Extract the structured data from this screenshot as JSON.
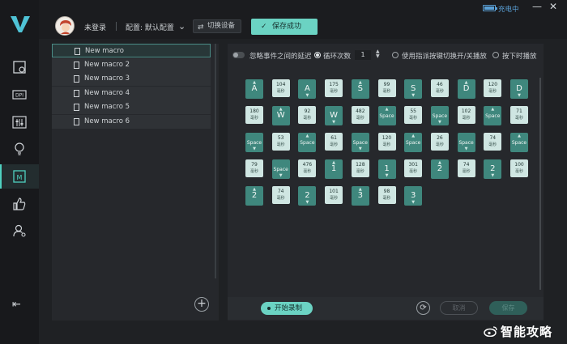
{
  "header": {
    "user_name": "未登录",
    "config_label": "配置: 默认配置",
    "switch_device": "切换设备",
    "save_status": "保存成功",
    "battery_level_percent": 100,
    "charging": "充电中"
  },
  "macros": [
    {
      "name": "New macro",
      "active": true
    },
    {
      "name": "New macro 2"
    },
    {
      "name": "New macro 3"
    },
    {
      "name": "New macro 4"
    },
    {
      "name": "New macro 5"
    },
    {
      "name": "New macro 6"
    }
  ],
  "options": {
    "ignore_delay": "忽略事件之间的延迟",
    "loop_count_label": "循环次数",
    "loop_count": "1",
    "toggle_mode": "使用指派按键切换开/关播放",
    "press_mode": "按下时播放"
  },
  "events": [
    {
      "type": "key",
      "label": "A",
      "dir": "down"
    },
    {
      "type": "delay",
      "value": "104",
      "unit": "毫秒"
    },
    {
      "type": "key",
      "label": "A",
      "dir": "up"
    },
    {
      "type": "delay",
      "value": "175",
      "unit": "毫秒"
    },
    {
      "type": "key",
      "label": "S",
      "dir": "down"
    },
    {
      "type": "delay",
      "value": "99",
      "unit": "毫秒"
    },
    {
      "type": "key",
      "label": "S",
      "dir": "up"
    },
    {
      "type": "delay",
      "value": "46",
      "unit": "毫秒"
    },
    {
      "type": "key",
      "label": "D",
      "dir": "down"
    },
    {
      "type": "delay",
      "value": "120",
      "unit": "毫秒"
    },
    {
      "type": "key",
      "label": "D",
      "dir": "up"
    },
    {
      "type": "delay",
      "value": "180",
      "unit": "毫秒"
    },
    {
      "type": "key",
      "label": "W",
      "dir": "down"
    },
    {
      "type": "delay",
      "value": "92",
      "unit": "毫秒"
    },
    {
      "type": "key",
      "label": "W",
      "dir": "up"
    },
    {
      "type": "delay",
      "value": "482",
      "unit": "毫秒"
    },
    {
      "type": "key",
      "label": "Space",
      "dir": "down"
    },
    {
      "type": "delay",
      "value": "55",
      "unit": "毫秒"
    },
    {
      "type": "key",
      "label": "Space",
      "dir": "up"
    },
    {
      "type": "delay",
      "value": "102",
      "unit": "毫秒"
    },
    {
      "type": "key",
      "label": "Space",
      "dir": "down"
    },
    {
      "type": "delay",
      "value": "71",
      "unit": "毫秒"
    },
    {
      "type": "key",
      "label": "Space",
      "dir": "up"
    },
    {
      "type": "delay",
      "value": "53",
      "unit": "毫秒"
    },
    {
      "type": "key",
      "label": "Space",
      "dir": "down"
    },
    {
      "type": "delay",
      "value": "61",
      "unit": "毫秒"
    },
    {
      "type": "key",
      "label": "Space",
      "dir": "up"
    },
    {
      "type": "delay",
      "value": "120",
      "unit": "毫秒"
    },
    {
      "type": "key",
      "label": "Space",
      "dir": "down"
    },
    {
      "type": "delay",
      "value": "26",
      "unit": "毫秒"
    },
    {
      "type": "key",
      "label": "Space",
      "dir": "up"
    },
    {
      "type": "delay",
      "value": "74",
      "unit": "毫秒"
    },
    {
      "type": "key",
      "label": "Space",
      "dir": "down"
    },
    {
      "type": "delay",
      "value": "79",
      "unit": "毫秒"
    },
    {
      "type": "key",
      "label": "Space",
      "dir": "up"
    },
    {
      "type": "delay",
      "value": "476",
      "unit": "毫秒"
    },
    {
      "type": "key",
      "label": "1",
      "dir": "down"
    },
    {
      "type": "delay",
      "value": "128",
      "unit": "毫秒"
    },
    {
      "type": "key",
      "label": "1",
      "dir": "up"
    },
    {
      "type": "delay",
      "value": "301",
      "unit": "毫秒"
    },
    {
      "type": "key",
      "label": "2",
      "dir": "down"
    },
    {
      "type": "delay",
      "value": "74",
      "unit": "毫秒"
    },
    {
      "type": "key",
      "label": "2",
      "dir": "up"
    },
    {
      "type": "delay",
      "value": "100",
      "unit": "毫秒"
    },
    {
      "type": "key",
      "label": "2",
      "dir": "down"
    },
    {
      "type": "delay",
      "value": "74",
      "unit": "毫秒"
    },
    {
      "type": "key",
      "label": "2",
      "dir": "up"
    },
    {
      "type": "delay",
      "value": "101",
      "unit": "毫秒"
    },
    {
      "type": "key",
      "label": "3",
      "dir": "down"
    },
    {
      "type": "delay",
      "value": "98",
      "unit": "毫秒"
    },
    {
      "type": "key",
      "label": "3",
      "dir": "up"
    }
  ],
  "footer": {
    "record": "开始录制",
    "cancel": "取消",
    "save": "保存"
  },
  "watermark": "智能攻略",
  "colors": {
    "accent": "#6bd3c3",
    "key_tile": "#3f877d",
    "delay_tile": "#cfe6e2",
    "background": "#1f2124"
  },
  "icons": {
    "rail": [
      "dashboard-icon",
      "dpi-icon",
      "sliders-icon",
      "bulb-icon",
      "macro-icon",
      "thumbs-up-icon",
      "user-settings-icon"
    ]
  }
}
